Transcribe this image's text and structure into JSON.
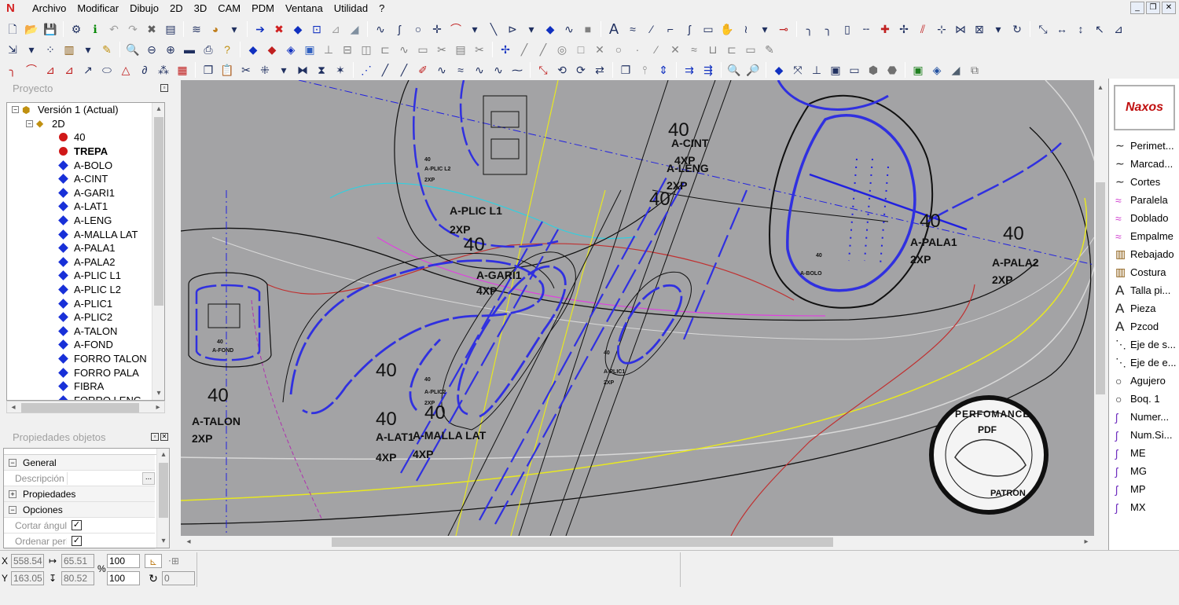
{
  "menu": {
    "items": [
      "Archivo",
      "Modificar",
      "Dibujo",
      "2D",
      "3D",
      "CAM",
      "PDM",
      "Ventana",
      "Utilidad",
      "?"
    ]
  },
  "project_panel": {
    "title": "Proyecto",
    "tree": {
      "root": "Versión 1 (Actual)",
      "child": "2D",
      "items": [
        {
          "label": "40",
          "kind": "red"
        },
        {
          "label": "TREPA",
          "kind": "red",
          "bold": true
        },
        {
          "label": "A-BOLO",
          "kind": "blue"
        },
        {
          "label": "A-CINT",
          "kind": "blue"
        },
        {
          "label": "A-GARI1",
          "kind": "blue"
        },
        {
          "label": "A-LAT1",
          "kind": "blue"
        },
        {
          "label": "A-LENG",
          "kind": "blue"
        },
        {
          "label": "A-MALLA LAT",
          "kind": "blue"
        },
        {
          "label": "A-PALA1",
          "kind": "blue"
        },
        {
          "label": "A-PALA2",
          "kind": "blue"
        },
        {
          "label": "A-PLIC L1",
          "kind": "blue"
        },
        {
          "label": "A-PLIC L2",
          "kind": "blue"
        },
        {
          "label": "A-PLIC1",
          "kind": "blue"
        },
        {
          "label": "A-PLIC2",
          "kind": "blue"
        },
        {
          "label": "A-TALON",
          "kind": "blue"
        },
        {
          "label": "A-FOND",
          "kind": "blue"
        },
        {
          "label": "FORRO TALON",
          "kind": "blue"
        },
        {
          "label": "FORRO PALA",
          "kind": "blue"
        },
        {
          "label": "FIBRA",
          "kind": "blue"
        },
        {
          "label": "FORRO LENG",
          "kind": "blue"
        }
      ]
    }
  },
  "props_panel": {
    "title": "Propiedades objetos",
    "rows": [
      {
        "label": "General",
        "type": "section",
        "sign": "−"
      },
      {
        "label": "Descripción",
        "type": "field",
        "value": ""
      },
      {
        "label": "Propiedades",
        "type": "section",
        "sign": "+"
      },
      {
        "label": "Opciones",
        "type": "section",
        "sign": "−"
      },
      {
        "label": "Cortar ángulos",
        "type": "check",
        "checked": true
      },
      {
        "label": "Ordenar períme",
        "type": "check",
        "checked": true
      }
    ]
  },
  "canvas_labels": [
    {
      "t": "40",
      "big": true
    },
    {
      "t": "A-CINT"
    },
    {
      "t": "4XP"
    },
    {
      "t": "A-LENG"
    },
    {
      "t": "2XP"
    },
    {
      "t": "40",
      "big": true
    },
    {
      "t": "A-PLIC L1"
    },
    {
      "t": "2XP"
    },
    {
      "t": "40",
      "big": true
    },
    {
      "t": "A-GARI1"
    },
    {
      "t": "4XP"
    },
    {
      "t": "40",
      "big": true
    },
    {
      "t": "A-PALA1"
    },
    {
      "t": "2XP"
    },
    {
      "t": "40",
      "big": true
    },
    {
      "t": "A-PALA2"
    },
    {
      "t": "2XP"
    },
    {
      "t": "40",
      "big": true
    },
    {
      "t": "A-TALON"
    },
    {
      "t": "2XP"
    },
    {
      "t": "40",
      "big": true
    },
    {
      "t": "40",
      "big": true
    },
    {
      "t": "A-LAT1"
    },
    {
      "t": "4XP"
    },
    {
      "t": "40",
      "big": true
    },
    {
      "t": "A-MALLA LAT"
    },
    {
      "t": "4XP"
    },
    {
      "t": "40"
    },
    {
      "t": "A-BOLO"
    },
    {
      "t": "40"
    },
    {
      "t": "A-PLIC2"
    },
    {
      "t": "2XP"
    },
    {
      "t": "40"
    },
    {
      "t": "A-PLIC1"
    },
    {
      "t": "2XP"
    },
    {
      "t": "40"
    },
    {
      "t": "A-FOND"
    },
    {
      "t": "40"
    },
    {
      "t": "A-PLIC L2"
    },
    {
      "t": "2XP"
    }
  ],
  "watermark": {
    "top": "PERFOMANCE",
    "mid": "PDF",
    "bottom": "PATRON"
  },
  "right_panel": {
    "logo": "Naxos",
    "items": [
      {
        "label": "Perimet...",
        "icon": "curve-icon"
      },
      {
        "label": "Marcad...",
        "icon": "curve-icon"
      },
      {
        "label": "Cortes",
        "icon": "curve-icon"
      },
      {
        "label": "Paralela",
        "icon": "parallel-icon"
      },
      {
        "label": "Doblado",
        "icon": "fold-icon"
      },
      {
        "label": "Empalme",
        "icon": "join-icon"
      },
      {
        "label": "Rebajado",
        "icon": "skive-icon"
      },
      {
        "label": "Costura",
        "icon": "seam-icon"
      },
      {
        "label": "Talla pi...",
        "icon": "text-icon"
      },
      {
        "label": "Pieza",
        "icon": "text-icon"
      },
      {
        "label": "Pzcod",
        "icon": "text-icon"
      },
      {
        "label": "Eje de s...",
        "icon": "axis-icon"
      },
      {
        "label": "Eje de e...",
        "icon": "axis-icon"
      },
      {
        "label": "Agujero",
        "icon": "circle-icon"
      },
      {
        "label": "Boq. 1",
        "icon": "circle-icon"
      },
      {
        "label": "Numer...",
        "icon": "pen-icon"
      },
      {
        "label": "Num.Si...",
        "icon": "pen-icon"
      },
      {
        "label": "ME",
        "icon": "pen-icon"
      },
      {
        "label": "MG",
        "icon": "pen-icon"
      },
      {
        "label": "MP",
        "icon": "pen-icon"
      },
      {
        "label": "MX",
        "icon": "pen-icon"
      }
    ]
  },
  "status": {
    "x_label": "X",
    "y_label": "Y",
    "x": "558.54",
    "y": "163.05",
    "dx": "65.51",
    "dy": "80.52",
    "pct_label": "%",
    "scale1": "100",
    "scale2": "100",
    "extra": "0"
  }
}
